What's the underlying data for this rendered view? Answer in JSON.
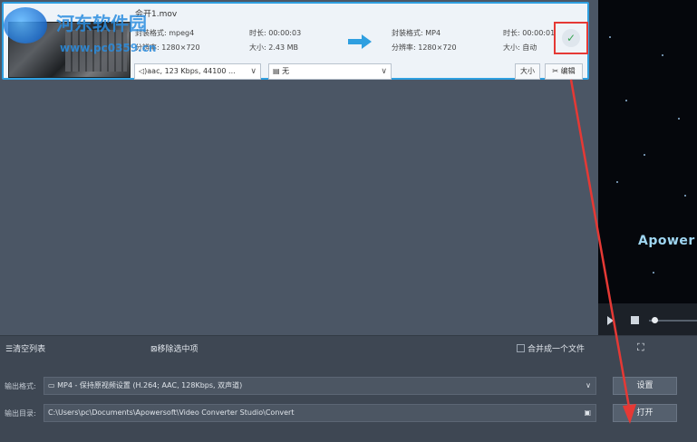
{
  "file": {
    "name": "会开1.mov",
    "source": {
      "format_label": "封装格式:",
      "format_value": "mpeg4",
      "resolution_label": "分辨率:",
      "resolution_value": "1280×720",
      "duration_label": "时长:",
      "duration_value": "00:00:03",
      "size_label": "大小:",
      "size_value": "2.43 MB"
    },
    "output": {
      "format_label": "封装格式:",
      "format_value": "MP4",
      "resolution_label": "分辨率:",
      "resolution_value": "1280×720",
      "duration_label": "时长:",
      "duration_value": "00:00:01",
      "size_label": "大小:",
      "size_value": "自动"
    },
    "audio_track": "aac, 123 Kbps, 44100 ...",
    "subtitle": "无",
    "size_button": "大小",
    "edit_button": "编辑",
    "status_icon": "check-icon"
  },
  "preview": {
    "overlay_text": "Apower"
  },
  "toolbar": {
    "clear_list": "清空列表",
    "remove_selected": "移除选中项",
    "merge_label": "合并成一个文件",
    "merge_checked": false
  },
  "output": {
    "format_label": "输出格式:",
    "format_value": "MP4 - 保持原视频设置 (H.264; AAC, 128Kbps, 双声道)",
    "dir_label": "输出目录:",
    "dir_value": "C:\\Users\\pc\\Documents\\Apowersoft\\Video Converter Studio\\Convert",
    "settings_button": "设置",
    "open_button": "打开"
  },
  "watermark": {
    "title": "河东软件园",
    "url": "www.pc0359.cn"
  },
  "colors": {
    "accent": "#2f9fe0",
    "highlight": "#e53935",
    "check": "#3aa655"
  }
}
